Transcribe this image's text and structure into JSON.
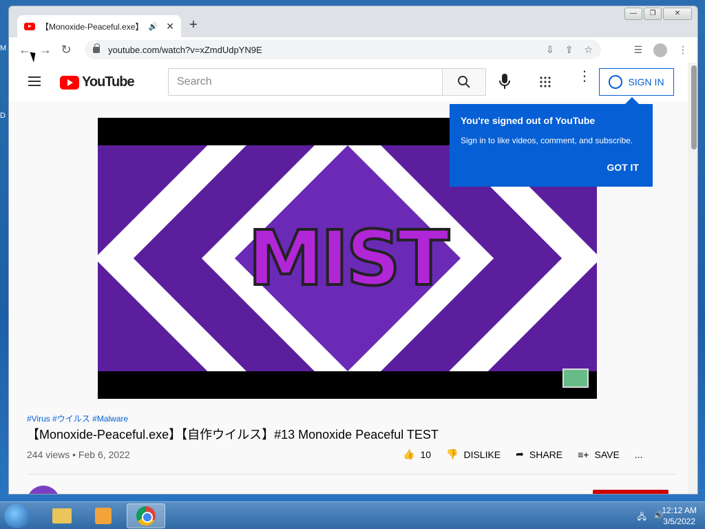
{
  "desktop": {
    "left_labels": [
      "M",
      "D"
    ]
  },
  "browser": {
    "tab_title": "【Monoxide-Peaceful.exe】【自",
    "url": "youtube.com/watch?v=xZmdUdpYN9E",
    "new_tab_label": "+"
  },
  "youtube": {
    "logo_text": "YouTube",
    "search_placeholder": "Search",
    "signin_label": "SIGN IN",
    "popup": {
      "title": "You're signed out of YouTube",
      "body": "Sign in to like videos, comment, and subscribe.",
      "button": "GOT IT"
    },
    "video": {
      "thumbnail_text": "MIST",
      "tags": "#Virus #ウイルス #Malware",
      "title": "【Monoxide-Peaceful.exe】【自作ウイルス】#13 Monoxide Peaceful TEST",
      "meta": "244 views • Feb 6, 2022",
      "likes": "10",
      "dislike_label": "DISLIKE",
      "share_label": "SHARE",
      "save_label": "SAVE",
      "more_label": "..."
    },
    "colors": {
      "accent": "#065fd4",
      "brand": "#ff0000"
    }
  },
  "taskbar": {
    "clock_time": "12:12 AM",
    "clock_date": "3/5/2022",
    "items": [
      "folder-icon",
      "media-player-icon",
      "chrome-icon"
    ]
  }
}
